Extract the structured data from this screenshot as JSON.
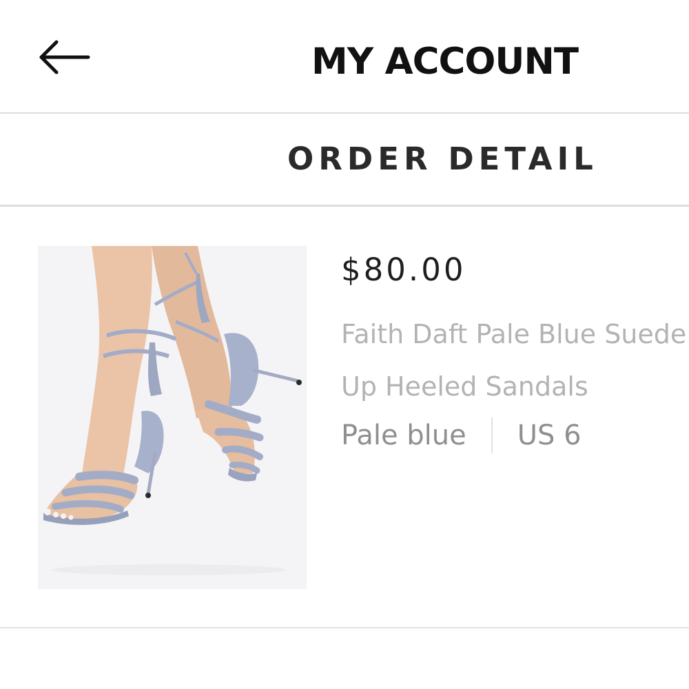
{
  "header": {
    "title": "MY ACCOUNT",
    "back_icon": "arrow-left-icon"
  },
  "subheader": {
    "title": "ORDER DETAIL"
  },
  "order_item": {
    "price": "$80.00",
    "name_line1": "Faith Daft Pale Blue Suede C",
    "name_line2": "Up Heeled Sandals",
    "color": "Pale blue",
    "size": "US 6"
  },
  "colors": {
    "text_primary": "#111111",
    "text_muted": "#b3b3b3",
    "divider": "#dcdcdc",
    "suede": "#a8b1cb"
  }
}
